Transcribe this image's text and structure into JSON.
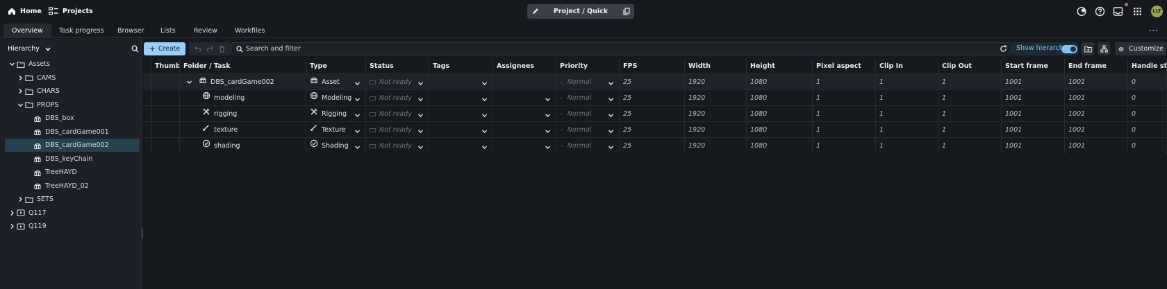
{
  "topbar": {
    "home_label": "Home",
    "projects_label": "Projects",
    "project_selector": "Project / Quick",
    "avatar_initials": "LLT",
    "notification_color": "#e0605a"
  },
  "tabs": [
    {
      "label": "Overview",
      "active": true
    },
    {
      "label": "Task progress",
      "active": false
    },
    {
      "label": "Browser",
      "active": false
    },
    {
      "label": "Lists",
      "active": false
    },
    {
      "label": "Review",
      "active": false
    },
    {
      "label": "Workfiles",
      "active": false
    }
  ],
  "tabs_more": "...",
  "sidebar": {
    "view_select": "Hierarchy",
    "tree": [
      {
        "label": "Assets",
        "expanded": true,
        "icon": "folder-icon",
        "level": 0
      },
      {
        "label": "CAMS",
        "expanded": false,
        "icon": "folder-icon",
        "level": 1
      },
      {
        "label": "CHARS",
        "expanded": false,
        "icon": "folder-icon",
        "level": 1
      },
      {
        "label": "PROPS",
        "expanded": true,
        "icon": "folder-icon",
        "level": 1
      },
      {
        "label": "DBS_box",
        "icon": "asset-icon",
        "level": 2
      },
      {
        "label": "DBS_cardGame001",
        "icon": "asset-icon",
        "level": 2
      },
      {
        "label": "DBS_cardGame002",
        "icon": "asset-icon",
        "level": 2,
        "selected": true
      },
      {
        "label": "DBS_keyChain",
        "icon": "asset-icon",
        "level": 2
      },
      {
        "label": "TreeHAYD",
        "icon": "asset-icon",
        "level": 2
      },
      {
        "label": "TreeHAYD_02",
        "icon": "asset-icon",
        "level": 2
      },
      {
        "label": "SETS",
        "expanded": false,
        "icon": "folder-icon",
        "level": 1
      },
      {
        "label": "Q117",
        "expanded": false,
        "icon": "sequence-icon",
        "level": 0
      },
      {
        "label": "Q119",
        "expanded": false,
        "icon": "sequence-icon",
        "level": 0
      }
    ]
  },
  "toolbar": {
    "create_label": "Create",
    "search_placeholder": "Search and filter",
    "show_hierarchy_label": "Show hierarchy",
    "show_hierarchy_on": true,
    "customize_label": "Customize"
  },
  "table": {
    "columns": [
      "Thumbnail",
      "Folder / Task",
      "Type",
      "Status",
      "Tags",
      "Assignees",
      "Priority",
      "FPS",
      "Width",
      "Height",
      "Pixel aspect",
      "Clip In",
      "Clip Out",
      "Start frame",
      "End frame",
      "Handle start"
    ],
    "rows": [
      {
        "name": "DBS_cardGame002",
        "icon": "asset-icon",
        "type": "Asset",
        "type_icon": "asset-icon",
        "status": "Not ready",
        "priority": "Normal",
        "values": [
          "25",
          "1920",
          "1080",
          "1",
          "1",
          "1",
          "1001",
          "1001",
          "0"
        ],
        "is_folder": true
      },
      {
        "name": "modeling",
        "icon": "globe-icon",
        "type": "Modeling",
        "type_icon": "globe-icon",
        "status": "Not ready",
        "priority": "Normal",
        "values": [
          "25",
          "1920",
          "1080",
          "1",
          "1",
          "1",
          "1001",
          "1001",
          "0"
        ]
      },
      {
        "name": "rigging",
        "icon": "rigging-tools-icon",
        "type": "Rigging",
        "type_icon": "rigging-tools-icon",
        "status": "Not ready",
        "priority": "Normal",
        "values": [
          "25",
          "1920",
          "1080",
          "1",
          "1",
          "1",
          "1001",
          "1001",
          "0"
        ]
      },
      {
        "name": "texture",
        "icon": "brush-icon",
        "type": "Texture",
        "type_icon": "brush-icon",
        "status": "Not ready",
        "priority": "Normal",
        "values": [
          "25",
          "1920",
          "1080",
          "1",
          "1",
          "1",
          "1001",
          "1001",
          "0"
        ]
      },
      {
        "name": "shading",
        "icon": "shading-icon",
        "type": "Shading",
        "type_icon": "shading-icon",
        "status": "Not ready",
        "priority": "Normal",
        "values": [
          "25",
          "1920",
          "1080",
          "1",
          "1",
          "1",
          "1001",
          "1001",
          "0"
        ]
      }
    ]
  }
}
